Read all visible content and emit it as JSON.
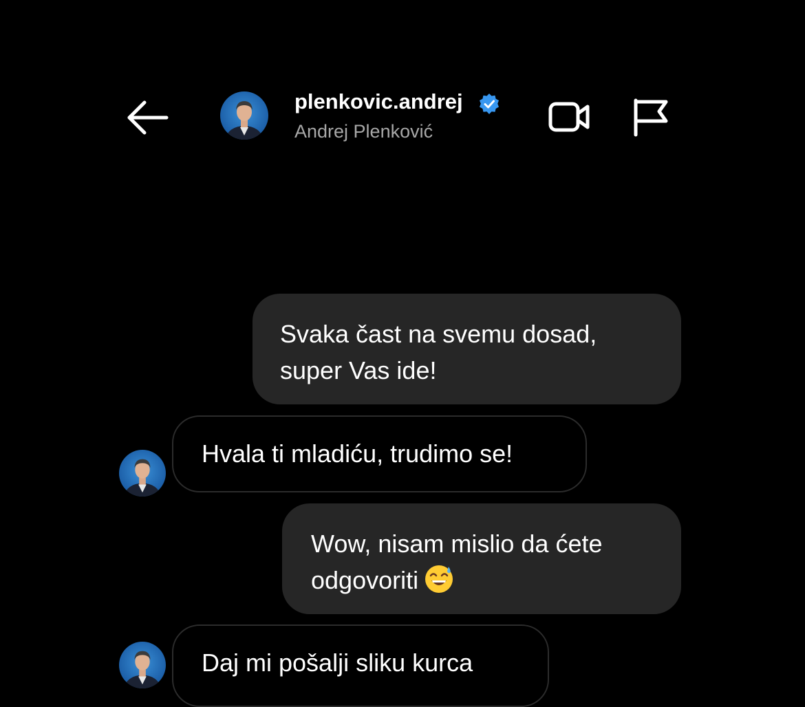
{
  "header": {
    "back_icon": "back-arrow-icon",
    "username": "plenkovic.andrej",
    "verified_icon": "verified-badge-icon",
    "full_name": "Andrej Plenković",
    "video_icon": "video-camera-icon",
    "report_icon": "flag-icon",
    "accent_color": "#3897f0"
  },
  "messages": [
    {
      "direction": "sent",
      "text": "Svaka čast na svemu dosad,\nsuper Vas ide!"
    },
    {
      "direction": "received",
      "text": "Hvala ti mladiću, trudimo se!"
    },
    {
      "direction": "sent",
      "text": "Wow, nisam mislio da ćete\nodgovoriti",
      "emoji": "sweat-smile-emoji"
    },
    {
      "direction": "received",
      "text": "Daj mi pošalji sliku kurca"
    }
  ],
  "colors": {
    "background": "#000000",
    "sent_bubble": "#262626",
    "received_border": "#2c2c2c",
    "secondary_text": "#a8a8a8"
  }
}
